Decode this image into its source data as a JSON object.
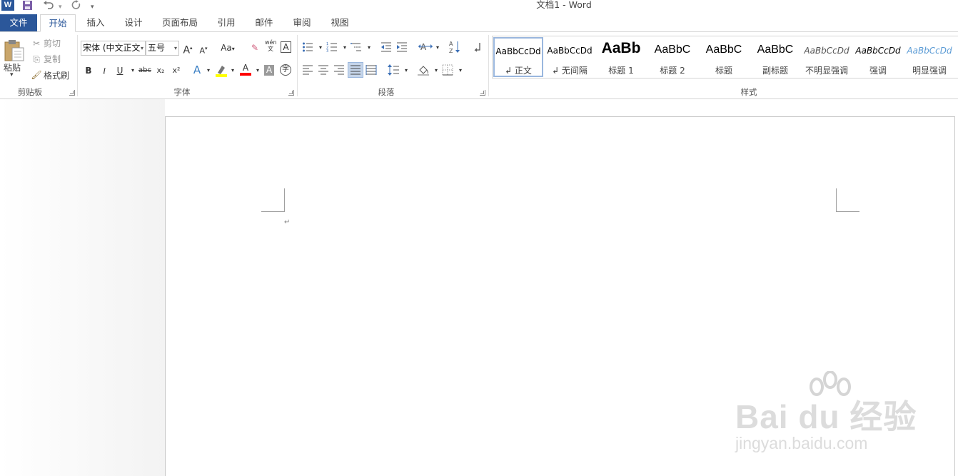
{
  "window": {
    "title": "文档1 - Word"
  },
  "quick_access": {
    "save_icon": "save-icon",
    "undo_icon": "undo-icon",
    "redo_icon": "redo-icon",
    "customize_icon": "customize-qat-icon"
  },
  "tabs": [
    {
      "label": "文件"
    },
    {
      "label": "开始"
    },
    {
      "label": "插入"
    },
    {
      "label": "设计"
    },
    {
      "label": "页面布局"
    },
    {
      "label": "引用"
    },
    {
      "label": "邮件"
    },
    {
      "label": "审阅"
    },
    {
      "label": "视图"
    }
  ],
  "clipboard": {
    "group_label": "剪贴板",
    "paste_label": "粘贴",
    "cut_label": "剪切",
    "copy_label": "复制",
    "format_painter_label": "格式刷"
  },
  "font": {
    "group_label": "字体",
    "font_name": "宋体 (中文正文",
    "font_size": "五号",
    "grow_label": "A",
    "shrink_label": "A",
    "change_case_label": "Aa",
    "phonetic_label": "wén",
    "bold_label": "B",
    "italic_label": "I",
    "underline_label": "U",
    "strike_label": "abc",
    "subscript_label": "x₂",
    "superscript_label": "x²",
    "font_color_label": "A",
    "char_shading_label": "A",
    "enclose_label": "字"
  },
  "paragraph": {
    "group_label": "段落"
  },
  "styles": {
    "group_label": "样式",
    "items": [
      {
        "preview": "AaBbCcDd",
        "name": "↲ 正文"
      },
      {
        "preview": "AaBbCcDd",
        "name": "↲ 无间隔"
      },
      {
        "preview": "AaBb",
        "name": "标题 1"
      },
      {
        "preview": "AaBbC",
        "name": "标题 2"
      },
      {
        "preview": "AaBbC",
        "name": "标题"
      },
      {
        "preview": "AaBbC",
        "name": "副标题"
      },
      {
        "preview": "AaBbCcDd",
        "name": "不明显强调"
      },
      {
        "preview": "AaBbCcDd",
        "name": "强调"
      },
      {
        "preview": "AaBbCcDd",
        "name": "明显强调"
      }
    ]
  },
  "document": {
    "paragraph_mark": "↵"
  },
  "watermark": {
    "main": "Bai du 经验",
    "sub": "jingyan.baidu.com"
  },
  "colors": {
    "accent": "#2b579a",
    "highlight": "#ffff00",
    "font_color": "#ff0000"
  }
}
